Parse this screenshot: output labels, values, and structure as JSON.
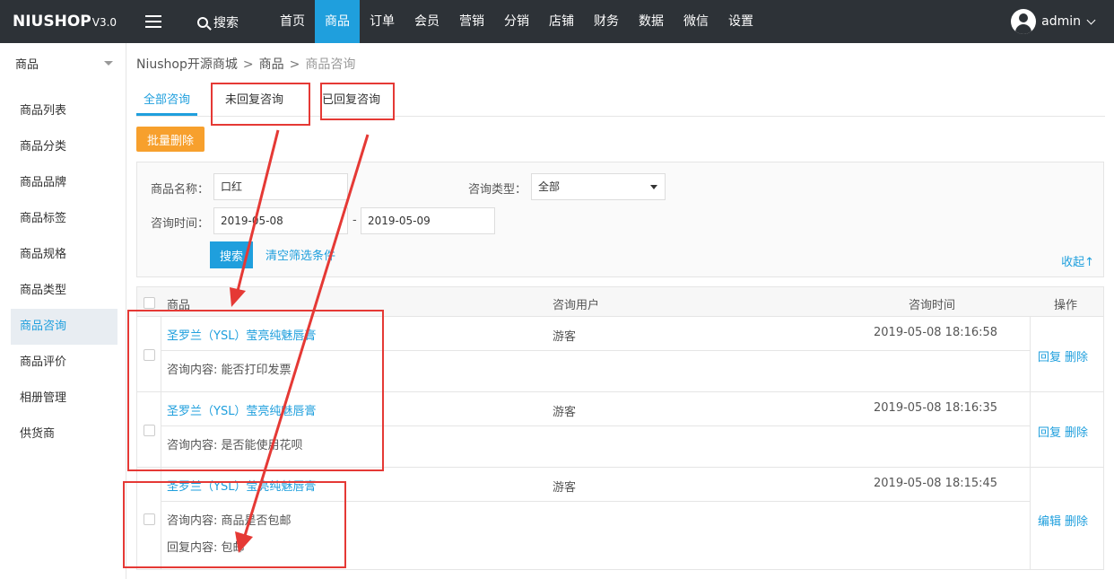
{
  "header": {
    "logo_main": "NIUSHOP",
    "logo_version": "V3.0",
    "search_label": "搜索",
    "nav": [
      "首页",
      "商品",
      "订单",
      "会员",
      "营销",
      "分销",
      "店铺",
      "财务",
      "数据",
      "微信",
      "设置"
    ],
    "active_nav": "商品",
    "user_name": "admin"
  },
  "sidebar": {
    "section_title": "商品",
    "items": [
      "商品列表",
      "商品分类",
      "商品品牌",
      "商品标签",
      "商品规格",
      "商品类型",
      "商品咨询",
      "商品评价",
      "相册管理",
      "供货商"
    ],
    "active_item": "商品咨询"
  },
  "breadcrumb": {
    "items": [
      "Niushop开源商城",
      "商品",
      "商品咨询"
    ],
    "separator": ">"
  },
  "tabs": [
    "全部咨询",
    "未回复咨询",
    "已回复咨询"
  ],
  "toolbar": {
    "batch_delete": "批量删除"
  },
  "filter": {
    "product_name_label": "商品名称：",
    "product_name_value": "口红",
    "consult_type_label": "咨询类型：",
    "consult_type_value": "全部",
    "consult_time_label": "咨询时间：",
    "date_from": "2019-05-08",
    "date_to": "2019-05-09",
    "date_separator": "-",
    "search_button": "搜索",
    "clear_link": "清空筛选条件",
    "collapse_link": "收起↑"
  },
  "table": {
    "headers": [
      "商品",
      "咨询用户",
      "咨询时间",
      "操作"
    ],
    "rows": [
      {
        "product": "圣罗兰（YSL）莹亮纯魅唇膏",
        "user": "游客",
        "time": "2019-05-08 18:16:58",
        "content": "咨询内容: 能否打印发票",
        "actions": [
          "回复",
          "删除"
        ]
      },
      {
        "product": "圣罗兰（YSL）莹亮纯魅唇膏",
        "user": "游客",
        "time": "2019-05-08 18:16:35",
        "content": "咨询内容: 是否能使用花呗",
        "actions": [
          "回复",
          "删除"
        ]
      },
      {
        "product": "圣罗兰（YSL）莹亮纯魅唇膏",
        "user": "游客",
        "time": "2019-05-08 18:15:45",
        "content": "咨询内容: 商品是否包邮",
        "reply": "回复内容: 包邮",
        "actions": [
          "编辑",
          "删除"
        ]
      }
    ]
  },
  "colors": {
    "topbar": "#2d3237",
    "accent": "#1f9fdd",
    "batch_button": "#f7a02d",
    "annotation": "#e53935"
  }
}
